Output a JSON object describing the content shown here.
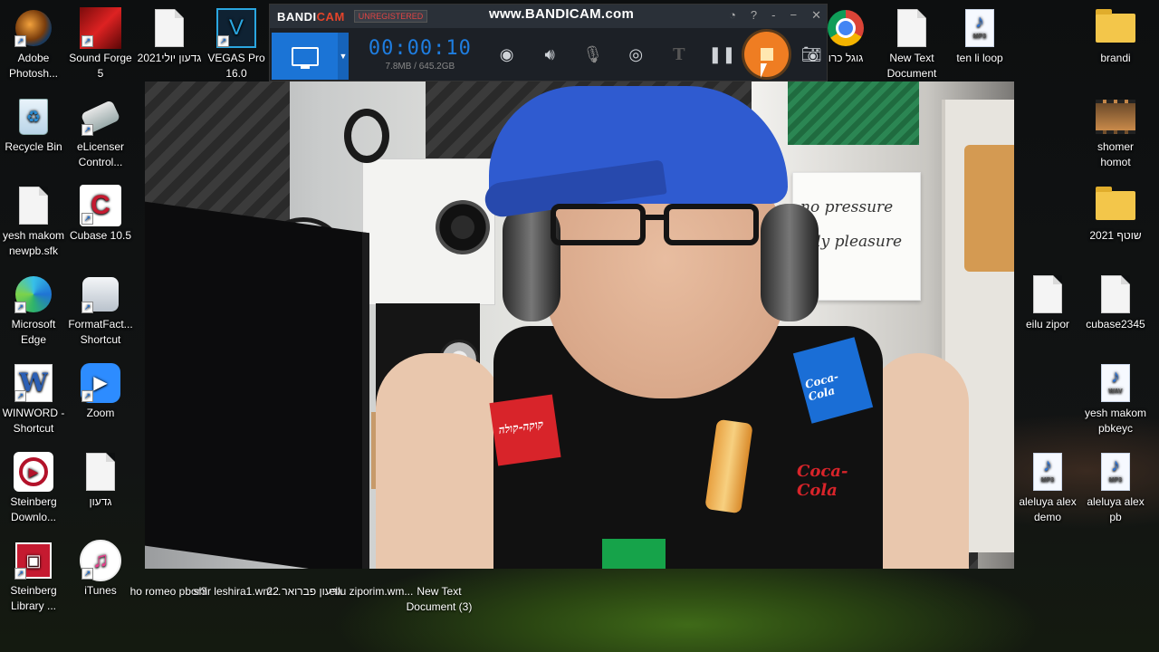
{
  "bandicam": {
    "brand_left": "BANDI",
    "brand_right": "CAM",
    "unregistered": "UNREGISTERED",
    "watermark": "www.BANDICAM.com",
    "timer": "00:00:10",
    "size": "7.8MB / 645.2GB",
    "title_buttons": [
      "◔",
      "?",
      "-",
      "−",
      "✕"
    ]
  },
  "webcam_board": {
    "line1": "no pressure",
    "line2": "only pleasure"
  },
  "shirt": {
    "patch1": "Coca-Cola",
    "patch2": "Coca-Cola",
    "patch3": "קוקה-קולה"
  },
  "desktop_left": [
    {
      "label": "Adobe Photosh...",
      "icon": "photoshop-icon"
    },
    {
      "label": "Recycle Bin",
      "icon": "recycle-bin-icon"
    },
    {
      "label": "yesh makom newpb.sfk",
      "icon": "document-icon"
    },
    {
      "label": "Microsoft Edge",
      "icon": "edge-icon"
    },
    {
      "label": "WINWORD - Shortcut",
      "icon": "word-icon"
    },
    {
      "label": "Steinberg Downlo...",
      "icon": "steinberg-download-icon"
    },
    {
      "label": "Steinberg Library ...",
      "icon": "steinberg-library-icon"
    }
  ],
  "desktop_col2": [
    {
      "label": "Sound Forge 5",
      "icon": "sound-forge-icon"
    },
    {
      "label": "eLicenser Control...",
      "icon": "elicenser-icon"
    },
    {
      "label": "Cubase 10.5",
      "icon": "cubase-icon"
    },
    {
      "label": "FormatFact... Shortcut",
      "icon": "format-factory-icon"
    },
    {
      "label": "Zoom",
      "icon": "zoom-icon"
    },
    {
      "label": "גדעון",
      "icon": "document-icon"
    },
    {
      "label": "iTunes",
      "icon": "itunes-icon"
    }
  ],
  "desktop_top": [
    {
      "label": "גדעון יולי2021",
      "icon": "document-icon"
    },
    {
      "label": "VEGAS Pro 16.0",
      "icon": "vegas-icon"
    },
    {
      "label": "גוגל כרו",
      "icon": "chrome-icon"
    },
    {
      "label": "New Text Document",
      "icon": "document-icon"
    },
    {
      "label": "ten li loop",
      "icon": "mp3-icon"
    }
  ],
  "desktop_right": [
    {
      "label": "brandi",
      "icon": "folder-icon"
    },
    {
      "label": "shomer homot",
      "icon": "video-icon"
    },
    {
      "label": "שוטף 2021",
      "icon": "folder-icon"
    },
    {
      "label": "cubase2345",
      "icon": "document-icon"
    },
    {
      "label": "yesh makom pbkeyc",
      "icon": "wav-icon"
    },
    {
      "label": "aleluya alex pb",
      "icon": "mp3-icon"
    }
  ],
  "desktop_right2": [
    {
      "label": "eilu zipor",
      "icon": "document-icon"
    },
    {
      "label": "aleluya alex demo",
      "icon": "mp3-icon"
    }
  ],
  "desktop_bottom": [
    {
      "label": "ho romeo pbor3"
    },
    {
      "label": "shir leshira1.wm..."
    },
    {
      "label": "גדעון פברואר 22"
    },
    {
      "label": "eilu ziporim.wm..."
    },
    {
      "label": "New Text Document (3)"
    }
  ],
  "badges": {
    "mp3": "MP3",
    "wav": "WAV",
    "word": "W",
    "vegas": "V"
  }
}
